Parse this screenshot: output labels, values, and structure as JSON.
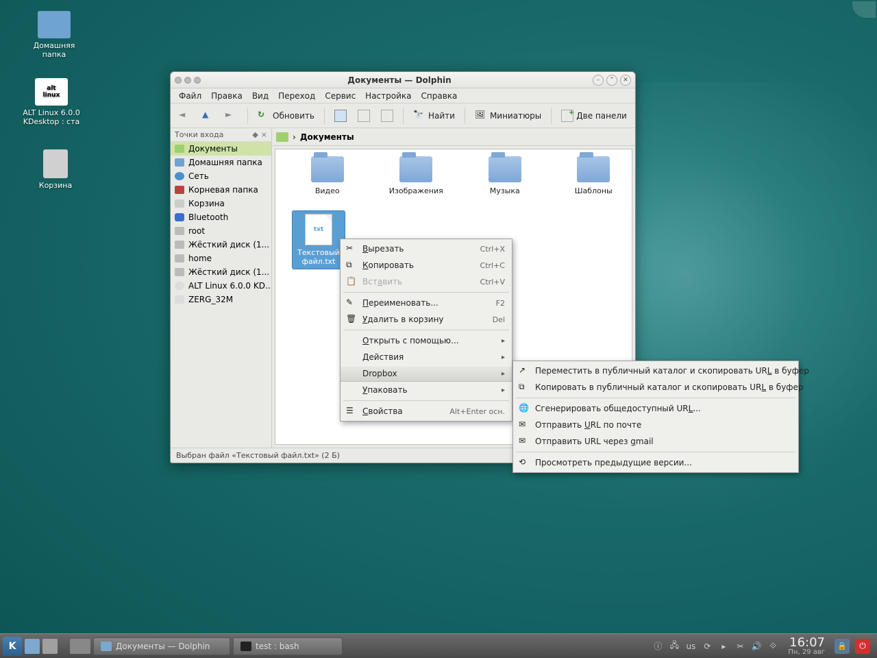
{
  "desktop": {
    "icons": [
      {
        "name": "home-folder",
        "label": "Домашняя\nпапка"
      },
      {
        "name": "alt-linux",
        "label": "ALT Linux 6.0.0\nKDesktop : ста"
      },
      {
        "name": "trash",
        "label": "Корзина"
      }
    ]
  },
  "window": {
    "title": "Документы — Dolphin",
    "menubar": [
      "Файл",
      "Правка",
      "Вид",
      "Переход",
      "Сервис",
      "Настройка",
      "Справка"
    ],
    "toolbar": {
      "refresh": "Обновить",
      "find": "Найти",
      "thumbs": "Миниатюры",
      "twoPanes": "Две панели"
    },
    "places": {
      "header": "Точки входа",
      "items": [
        "Документы",
        "Домашняя папка",
        "Сеть",
        "Корневая папка",
        "Корзина",
        "Bluetooth",
        "root",
        "Жёсткий диск (1...",
        "home",
        "Жёсткий диск (1...",
        "ALT Linux 6.0.0 KD...",
        "ZERG_32M"
      ]
    },
    "path": {
      "sep": "›",
      "current": "Документы"
    },
    "files": {
      "folders": [
        "Видео",
        "Изображения",
        "Музыка",
        "Шаблоны"
      ],
      "selected": {
        "line1": "Текстовый",
        "line2": "файл.txt",
        "iconText": "txt"
      }
    },
    "status": "Выбран файл «Текстовый файл.txt» (2 Б)"
  },
  "ctx1": {
    "cut": {
      "label": "Вырезать",
      "short": "Ctrl+X"
    },
    "copy": {
      "label": "Копировать",
      "short": "Ctrl+C"
    },
    "paste": {
      "label": "Вставить",
      "short": "Ctrl+V"
    },
    "rename": {
      "label": "Переименовать...",
      "short": "F2"
    },
    "trash": {
      "label": "Удалить в корзину",
      "short": "Del"
    },
    "openwith": {
      "label": "Открыть с помощью..."
    },
    "actions": {
      "label": "Действия"
    },
    "dropbox": {
      "label": "Dropbox"
    },
    "pack": {
      "label": "Упаковать"
    },
    "props": {
      "label": "Свойства",
      "short": "Alt+Enter осн."
    }
  },
  "ctx2": {
    "movePublic": "Переместить в публичный каталог и скопировать URL в буфер",
    "copyPublic": "Копировать в публичный каталог и скопировать URL в буфер",
    "genUrl": "Сгенерировать общедоступный URL...",
    "mailUrl": "Отправить URL по почте",
    "gmailUrl": "Отправить URL через gmail",
    "prevVers": "Просмотреть предыдущие версии..."
  },
  "taskbar": {
    "tasks": [
      {
        "name": "dolphin",
        "label": "Документы — Dolphin"
      },
      {
        "name": "terminal",
        "label": "test : bash"
      }
    ],
    "layout": "us",
    "time": "16:07",
    "date": "Пн, 29 авг"
  }
}
